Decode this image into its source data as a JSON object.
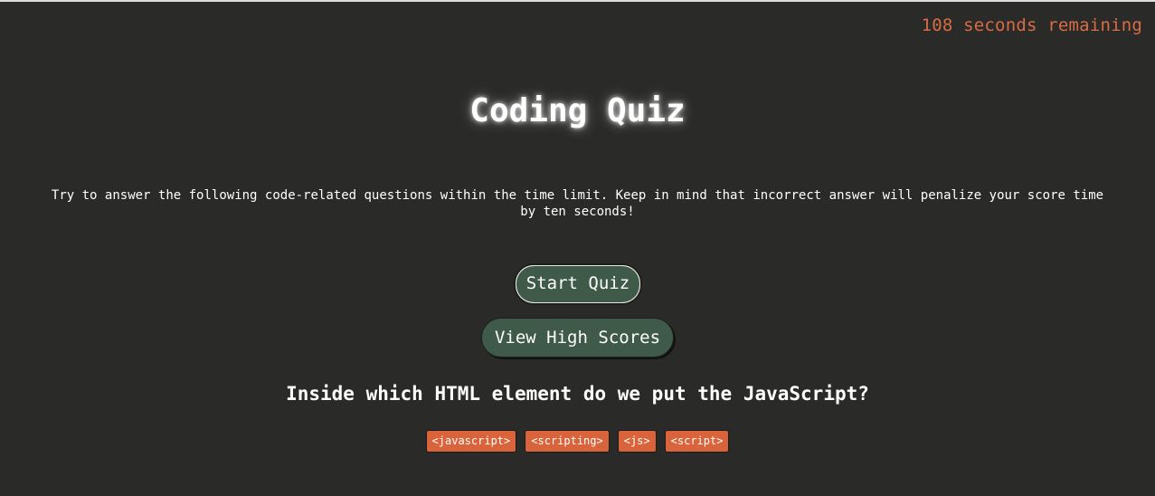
{
  "timer": {
    "text": "108 seconds remaining"
  },
  "header": {
    "title": "Coding Quiz"
  },
  "intro": {
    "text": "Try to answer the following code-related questions within the time limit. Keep in mind that incorrect answer will penalize your score time by ten seconds!"
  },
  "buttons": {
    "start_label": "Start Quiz",
    "scores_label": "View High Scores"
  },
  "quiz": {
    "question": "Inside which HTML element do we put the JavaScript?",
    "answers": [
      "<javascript>",
      "<scripting>",
      "<js>",
      "<script>"
    ]
  },
  "colors": {
    "background": "#2a2b29",
    "accent": "#d9643b",
    "button": "#3f5a48",
    "timer": "#d96b45"
  }
}
